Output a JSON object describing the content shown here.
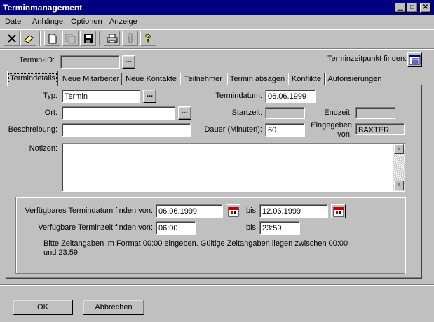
{
  "window": {
    "title": "Terminmanagement"
  },
  "menu": [
    "Datei",
    "Anhänge",
    "Optionen",
    "Anzeige"
  ],
  "toolbar": {
    "icons": [
      "delete-icon",
      "eraser-icon",
      "new-document-icon",
      "copy-icon",
      "save-icon",
      "print-icon",
      "attachment-icon",
      "help-icon"
    ]
  },
  "header": {
    "termin_id_label": "Termin-ID:",
    "termin_id_value": "",
    "dots": "...",
    "find_time_label": "Terminzeitpunkt finden:"
  },
  "tabs": [
    "Termindetails",
    "Neue Mitarbeiter",
    "Neue Kontakte",
    "Teilnehmer",
    "Termin absagen",
    "Konflikte",
    "Autorisierungen"
  ],
  "form": {
    "typ_label": "Typ:",
    "typ_value": "Termin",
    "ort_label": "Ort:",
    "ort_value": "",
    "beschreibung_label": "Beschreibung:",
    "beschreibung_value": "",
    "termindatum_label": "Termindatum:",
    "termindatum_value": "06.06.1999",
    "startzeit_label": "Startzeit:",
    "startzeit_value": "",
    "endzeit_label": "Endzeit:",
    "endzeit_value": "",
    "dauer_label": "Dauer (Minuten):",
    "dauer_value": "60",
    "eingegeben_label_1": "Eingegeben",
    "eingegeben_label_2": "von:",
    "eingegeben_value": "BAXTER",
    "notizen_label": "Notizen:",
    "notizen_value": ""
  },
  "finder": {
    "date_label": "Verfügbares Termindatum finden von:",
    "date_from": "06.06.1999",
    "bis_label": "bis:",
    "date_to": "12.06.1999",
    "time_label": "Verfügbare Terminzeit finden von:",
    "time_from": "06:00",
    "time_to": "23:59",
    "hint_line1": "Bitte Zeitangaben im Format 00:00 eingeben. Gültige Zeitangaben liegen zwischen 00:00",
    "hint_line2": "und 23:59"
  },
  "buttons": {
    "ok": "OK",
    "cancel": "Abbrechen"
  }
}
